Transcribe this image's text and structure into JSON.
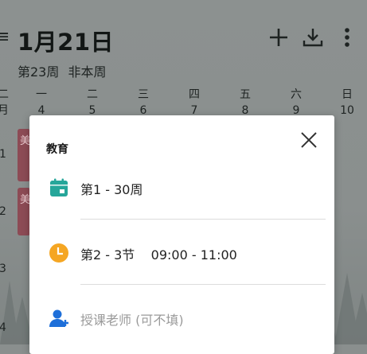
{
  "header": {
    "menu_glyph": "≡",
    "date_title": "1月21日",
    "week_info": "第23周 非本周",
    "icons": [
      "add-icon",
      "download-icon",
      "more-vert-icon"
    ]
  },
  "week_days": [
    {
      "day": "二",
      "date": "月"
    },
    {
      "day": "一",
      "date": "4"
    },
    {
      "day": "二",
      "date": "5"
    },
    {
      "day": "三",
      "date": "6"
    },
    {
      "day": "四",
      "date": "7"
    },
    {
      "day": "五",
      "date": "8"
    },
    {
      "day": "六",
      "date": "9"
    },
    {
      "day": "日",
      "date": "10"
    }
  ],
  "row_numbers": [
    "1",
    "2",
    "3",
    "4"
  ],
  "course_blocks": [
    "美",
    "美"
  ],
  "dialog": {
    "title": "教育",
    "weeks": "第1 - 30周",
    "time": "第2 - 3节    09:00 - 11:00",
    "teacher_placeholder": "授课老师 (可不填)"
  },
  "colors": {
    "calendar_icon": "#26a69a",
    "clock_icon": "#f5a623",
    "teacher_icon": "#1e6fd9"
  }
}
